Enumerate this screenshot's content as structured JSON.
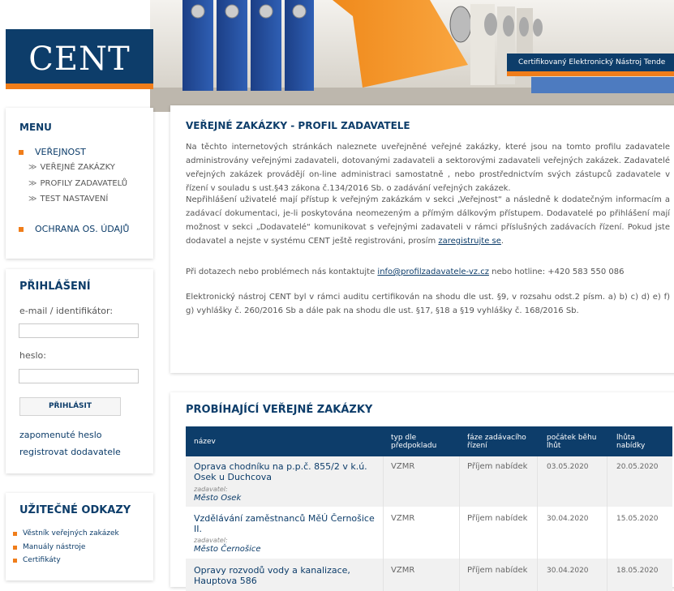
{
  "header": {
    "logo": "CENT",
    "tagline": "Certifikovaný Elektronický Nástroj Tende"
  },
  "menu": {
    "title": "MENU",
    "items": [
      {
        "label": "VEŘEJNOST"
      },
      {
        "label": "VEŘEJNÉ ZAKÁZKY"
      },
      {
        "label": "PROFILY ZADAVATELŮ"
      },
      {
        "label": "TEST NASTAVENÍ"
      },
      {
        "label": "OCHRANA OS. ÚDAJŮ"
      }
    ]
  },
  "login": {
    "title": "PŘIHLÁŠENÍ",
    "email_label": "e-mail / identifikátor:",
    "email_value": "",
    "password_label": "heslo:",
    "password_value": "",
    "button": "PŘIHLÁSIT",
    "forgot": "zapomenuté heslo",
    "register": "registrovat dodavatele"
  },
  "useful_links": {
    "title": "UŽITEČNÉ ODKAZY",
    "items": [
      "Věstník veřejných zakázek",
      "Manuály nástroje",
      "Certifikáty"
    ]
  },
  "intro": {
    "title": "VEŘEJNÉ ZAKÁZKY - PROFIL ZADAVATELE",
    "p1": "Na těchto internetových stránkách naleznete uveřejněné veřejné zakázky, které jsou na tomto profilu zadavatele administrovány veřejnými zadavateli, dotovanými zadavateli a sektorovými zadavateli veřejných zakázek. Zadavatelé veřejných zakázek provádějí on-line administraci samostatně , nebo prostřednictvím svých zástupců zadavatele v řízení v souladu s ust.§43 zákona č.134/2016 Sb. o zadávání veřejných zakázek.",
    "p2": "Nepřihlášení uživatelé mají přístup k veřejným zakázkám v sekci „Veřejnost“ a následně k dodatečným informacím a zadávací dokumentaci, je-li poskytována neomezeným a přímým dálkovým přístupem. Dodavatelé po přihlášení mají možnost v sekci „Dodavatelé“ komunikovat s veřejnými zadavateli v rámci příslušných zadávacích řízení. Pokud jste dodavatel a nejste v systému CENT ještě registrováni, prosím",
    "p2_link": "zaregistrujte se",
    "p2_end": ".",
    "p3_pre": "Při dotazech nebo problémech nás kontaktujte",
    "p3_email": "info@profilzadavatele-vz.cz",
    "p3_post": "nebo hotline: +420 583 550 086",
    "p4": "Elektronický nástroj CENT byl v rámci auditu certifikován na shodu dle ust. §9, v rozsahu odst.2 písm. a) b) c) d) e) f) g) vyhlášky č. 260/2016 Sb a dále pak na shodu dle ust. §17, §18 a §19 vyhlášky č. 168/2016 Sb."
  },
  "tenders": {
    "title": "PROBÍHAJÍCÍ VEŘEJNÉ ZAKÁZKY",
    "columns": [
      "název",
      "typ dle předpokladu",
      "fáze zadávacího řízení",
      "počátek běhu lhůt",
      "lhůta nabídky"
    ],
    "buyer_label": "zadavatel:",
    "rows": [
      {
        "name": "Oprava chodníku na p.p.č. 855/2 v k.ú. Osek u Duchcova",
        "buyer": "Město Osek",
        "type": "VZMR",
        "phase": "Příjem nabídek",
        "start": "03.05.2020",
        "deadline": "20.05.2020"
      },
      {
        "name": "Vzdělávání zaměstnanců MěÚ Černošice II.",
        "buyer": "Město Černošice",
        "type": "VZMR",
        "phase": "Příjem nabídek",
        "start": "30.04.2020",
        "deadline": "15.05.2020"
      },
      {
        "name": "Opravy rozvodů vody a kanalizace, Hauptova 586",
        "buyer": "",
        "type": "VZMR",
        "phase": "Příjem nabídek",
        "start": "30.04.2020",
        "deadline": "18.05.2020"
      }
    ]
  },
  "colors": {
    "navy": "#0d3d6a",
    "orange": "#f07d1a"
  }
}
